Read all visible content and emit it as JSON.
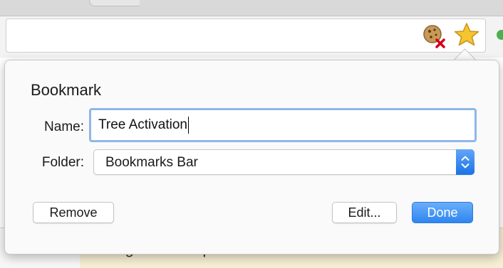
{
  "toolbar": {
    "icons": [
      "cookie-blocked-icon",
      "bookmark-star-icon",
      "extension-icon"
    ]
  },
  "page": {
    "note_text": "A good example is self-contained and succinct"
  },
  "bookmark_dialog": {
    "title": "Bookmark",
    "name_label": "Name:",
    "name_value": "Tree Activation",
    "folder_label": "Folder:",
    "folder_value": "Bookmarks Bar",
    "remove_label": "Remove",
    "edit_label": "Edit...",
    "done_label": "Done"
  },
  "colors": {
    "accent": "#2f86f0",
    "focus_ring": "#8fb7e9",
    "star": "#f5c431",
    "blocked": "#d0021b"
  }
}
